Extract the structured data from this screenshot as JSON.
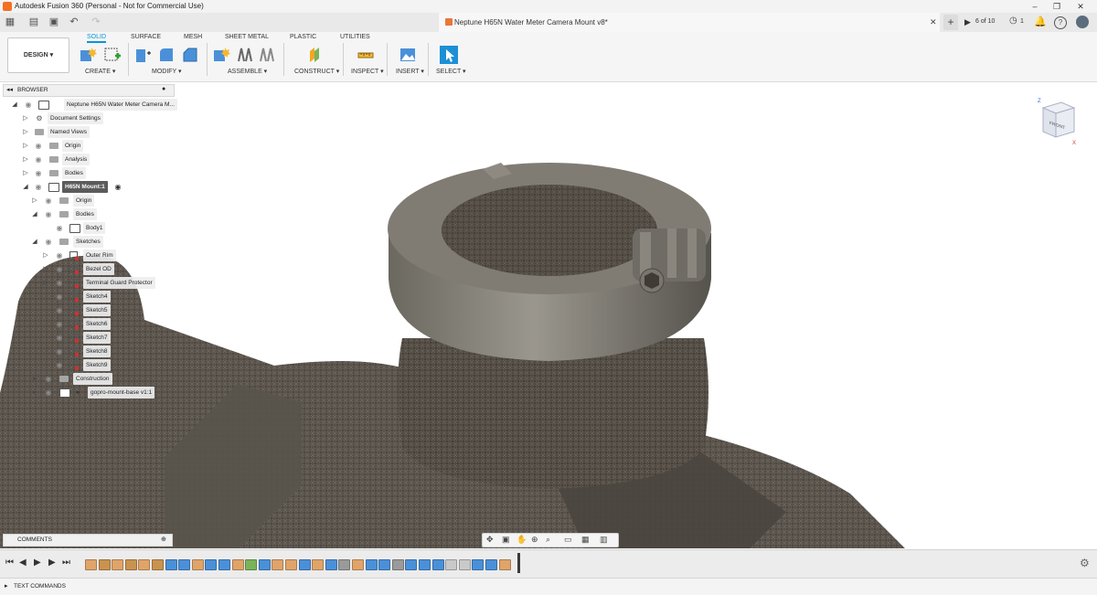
{
  "window": {
    "title": "Autodesk Fusion 360 (Personal - Not for Commercial Use)",
    "minimize": "–",
    "restore": "❐",
    "close": "✕"
  },
  "document": {
    "tab_title": "Neptune H65N Water Meter Camera Mount v8*",
    "close": "✕",
    "new_tab": "+",
    "version_count": "6 of 10",
    "jobs_count": "1"
  },
  "ribbon": {
    "workspace": "DESIGN ▾",
    "tabs": [
      "SOLID",
      "SURFACE",
      "MESH",
      "SHEET METAL",
      "PLASTIC",
      "UTILITIES"
    ],
    "groups": [
      "CREATE ▾",
      "MODIFY ▾",
      "ASSEMBLE ▾",
      "CONSTRUCT ▾",
      "INSPECT ▾",
      "INSERT ▾",
      "SELECT ▾"
    ],
    "accent": "#0696d7"
  },
  "browser": {
    "title": "BROWSER",
    "root": "Neptune H65N Water Meter Camera M...",
    "items": [
      "Document Settings",
      "Named Views",
      "Origin",
      "Analysis",
      "Bodies",
      "H65N Mount:1",
      "Origin",
      "Bodies",
      "Body1",
      "Sketches",
      "Outer Rim",
      "Bezel OD",
      "Terminal Guard Protector",
      "Sketch4",
      "Sketch5",
      "Sketch6",
      "Sketch7",
      "Sketch8",
      "Sketch9",
      "Construction",
      "gopro-mount-base v1:1"
    ]
  },
  "viewcube": {
    "face": "FRONT",
    "axis_z": "Z",
    "axis_x": "X"
  },
  "comments": {
    "title": "COMMENTS"
  },
  "text_commands": {
    "title": "TEXT COMMANDS"
  },
  "timeline": {
    "controls": [
      "⏮",
      "◀",
      "▶",
      "▶",
      "⏭"
    ],
    "feature_colors": [
      "#e0a46a",
      "#c9934f",
      "#e0a46a",
      "#c9934f",
      "#e0a46a",
      "#c9934f",
      "#4a90d9",
      "#4a90d9",
      "#e0a46a",
      "#4a90d9",
      "#4a90d9",
      "#e0a46a",
      "#7bb35a",
      "#4a90d9",
      "#e0a46a",
      "#e0a46a",
      "#4a90d9",
      "#e0a46a",
      "#4a90d9",
      "#9a9a9a",
      "#e0a46a",
      "#4a90d9",
      "#4a90d9",
      "#9a9a9a",
      "#4a90d9",
      "#4a90d9",
      "#4a90d9",
      "#c9c9c9",
      "#c9c9c9",
      "#4a90d9",
      "#4a90d9",
      "#e0a46a"
    ]
  }
}
